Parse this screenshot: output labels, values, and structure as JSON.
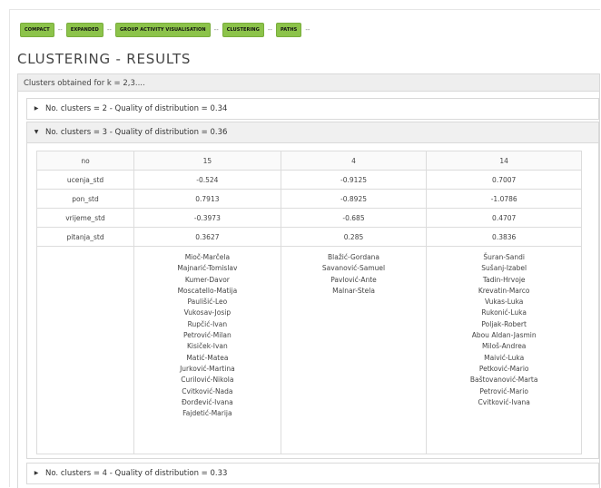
{
  "breadcrumb": [
    "COMPACT",
    "EXPANDED",
    "GROUP ACTIVITY VISUALISATION",
    "CLUSTERING",
    "PATHS"
  ],
  "breadcrumb_separator": "--",
  "page_title": "CLUSTERING - RESULTS",
  "panel": {
    "header": "Clusters obtained for k = 2,3...."
  },
  "accordions": [
    {
      "label": "No. clusters = 2 - Quality of distribution = 0.34",
      "expanded": false
    },
    {
      "label": "No. clusters = 3 - Quality of distribution = 0.36",
      "expanded": true
    },
    {
      "label": "No. clusters = 4 - Quality of distribution = 0.33",
      "expanded": false
    }
  ],
  "icons": {
    "collapsed": "triangle-right-icon",
    "expanded": "triangle-down-icon"
  },
  "colors": {
    "crumb_bg": "#8cc34a",
    "header_bg": "#eeeeee"
  },
  "table": {
    "header": {
      "label": "no",
      "values": [
        "15",
        "4",
        "14"
      ]
    },
    "rows": [
      {
        "label": "ucenja_std",
        "values": [
          "-0.524",
          "-0.9125",
          "0.7007"
        ]
      },
      {
        "label": "pon_std",
        "values": [
          "0.7913",
          "-0.8925",
          "-1.0786"
        ]
      },
      {
        "label": "vrijeme_std",
        "values": [
          "-0.3973",
          "-0.685",
          "0.4707"
        ]
      },
      {
        "label": "pitanja_std",
        "values": [
          "0.3627",
          "0.285",
          "0.3836"
        ]
      }
    ],
    "members": [
      [
        "Mioč-Marčela",
        "Majnarić-Tomislav",
        "Kumer-Davor",
        "Moscatello-Matija",
        "Paulišić-Leo",
        "Vukosav-Josip",
        "Rupčić-Ivan",
        "Petrović-Milan",
        "Kisiček-Ivan",
        "Matić-Matea",
        "Jurković-Martina",
        "Curilović-Nikola",
        "Cvitković-Nada",
        "Đorđević-Ivana",
        "Fajdetić-Marija"
      ],
      [
        "Blažić-Gordana",
        "Savanović-Samuel",
        "Pavlović-Ante",
        "Malnar-Stela"
      ],
      [
        "Šuran-Sandi",
        "Sušanj-Izabel",
        "Tadin-Hrvoje",
        "Krevatin-Marco",
        "Vukas-Luka",
        "Rukonić-Luka",
        "Poljak-Robert",
        "Abou Aldan-Jasmin",
        "Miloš-Andrea",
        "Maivić-Luka",
        "Petković-Mario",
        "Baštovanović-Marta",
        "Petrović-Mario",
        "Cvitković-Ivana"
      ]
    ]
  }
}
